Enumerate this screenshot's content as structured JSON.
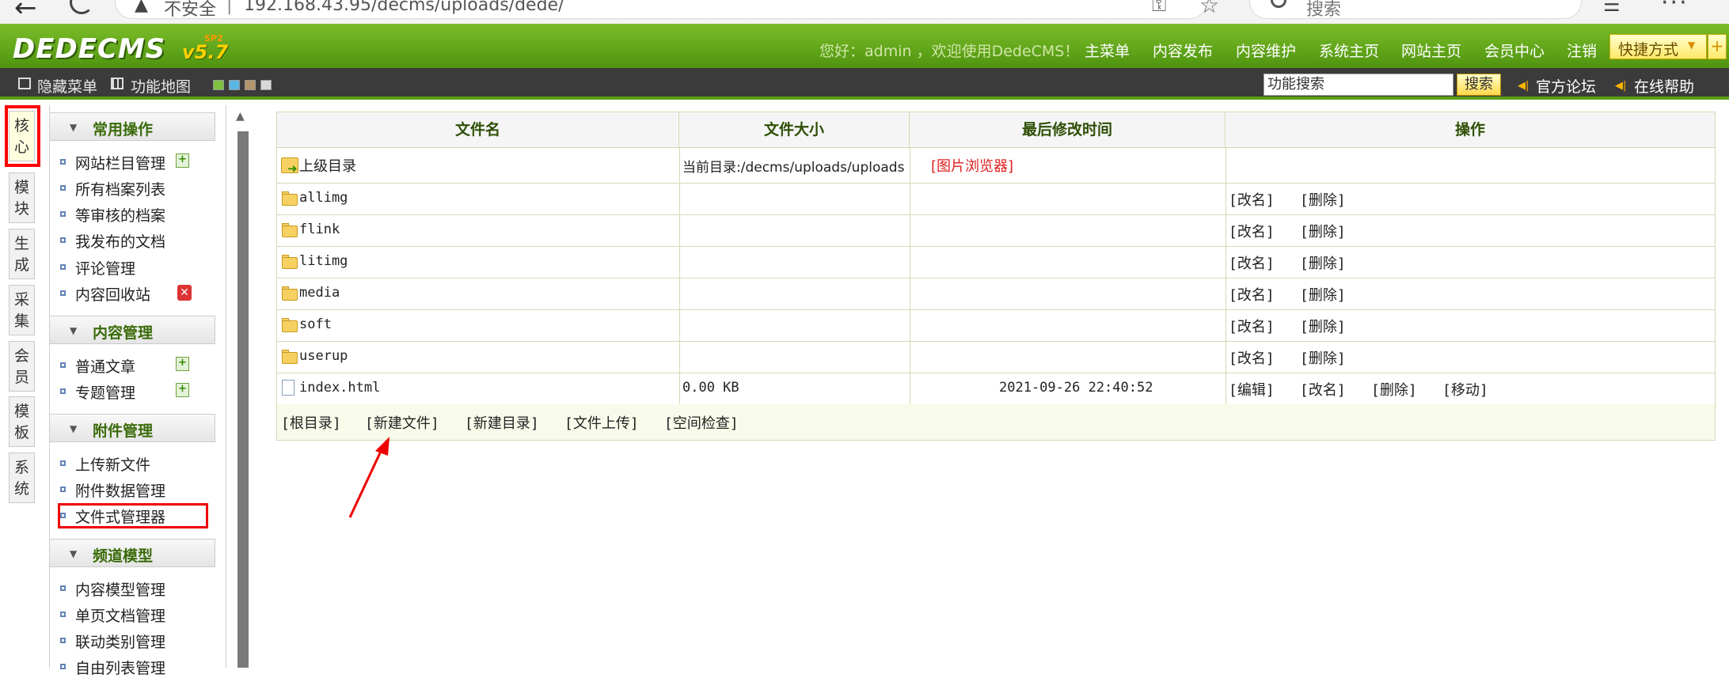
{
  "browser": {
    "back_icon": "←",
    "insecure_label": "不安全",
    "url_separator": "|",
    "url": "192.168.43.95/decms/uploads/dede/",
    "search_placeholder": "搜索",
    "more_icon": "···"
  },
  "header": {
    "logo": "DEDECMS",
    "logo_version": "v5.7",
    "logo_edition": "SP2",
    "welcome": "您好：admin ，欢迎使用DedeCMS！",
    "nav": [
      "主菜单",
      "内容发布",
      "内容维护",
      "系统主页",
      "网站主页",
      "会员中心",
      "注销"
    ],
    "quick_label": "快捷方式",
    "quick_plus": "+"
  },
  "toolbar": {
    "hide_menu": "隐藏菜单",
    "site_map": "功能地图",
    "swatch_colors": [
      "#7fc241",
      "#5bb7e5",
      "#b5946a",
      "#d8d8d8"
    ],
    "search_value": "功能搜索",
    "search_button": "搜索",
    "forum": "官方论坛",
    "help": "在线帮助"
  },
  "vertical_tabs": [
    "核心",
    "模块",
    "生成",
    "采集",
    "会员",
    "模板",
    "系统"
  ],
  "menu": {
    "sections": [
      {
        "title": "常用操作",
        "items": [
          "网站栏目管理",
          "所有档案列表",
          "等审核的档案",
          "我发布的文档",
          "评论管理",
          "内容回收站"
        ]
      },
      {
        "title": "内容管理",
        "items": [
          "普通文章",
          "专题管理"
        ]
      },
      {
        "title": "附件管理",
        "items": [
          "上传新文件",
          "附件数据管理",
          "文件式管理器"
        ]
      },
      {
        "title": "频道模型",
        "items": [
          "内容模型管理",
          "单页文档管理",
          "联动类别管理",
          "自由列表管理"
        ]
      }
    ]
  },
  "table": {
    "headers": [
      "文件名",
      "文件大小",
      "最后修改时间",
      "操作"
    ],
    "parent_row": {
      "name": "上级目录",
      "current_dir": "当前目录:/decms/uploads/uploads",
      "gallery_link": "[图片浏览器]"
    },
    "folders": [
      "allimg",
      "flink",
      "litimg",
      "media",
      "soft",
      "userup"
    ],
    "folder_actions": [
      "[改名]",
      "[删除]"
    ],
    "file": {
      "name": "index.html",
      "size": "0.00 KB",
      "modified": "2021-09-26 22:40:52",
      "actions": [
        "[编辑]",
        "[改名]",
        "[删除]",
        "[移动]"
      ]
    },
    "footer_links": [
      "[根目录]",
      "[新建文件]",
      "[新建目录]",
      "[文件上传]",
      "[空间检查]"
    ]
  },
  "colors": {
    "header_green": "#5fa31b",
    "toolbar_dark": "#3b3b3b",
    "annotation_red": "#ee0000",
    "section_text": "#3a6b0a"
  }
}
